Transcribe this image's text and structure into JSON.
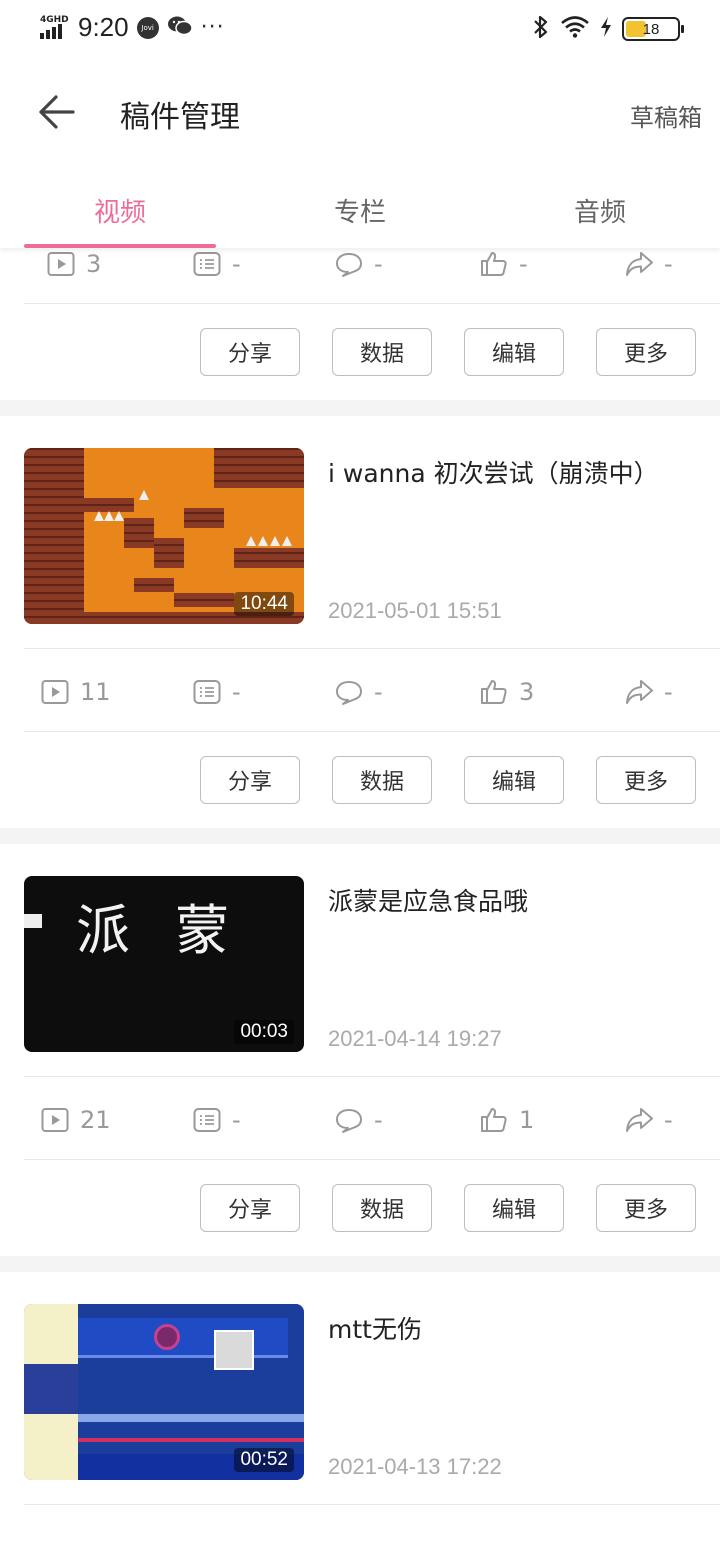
{
  "status_bar": {
    "network": "4GHD",
    "time": "9:20",
    "app_badge": "Jovi",
    "more": "···",
    "battery": "18"
  },
  "header": {
    "title": "稿件管理",
    "drafts_label": "草稿箱"
  },
  "tabs": [
    {
      "label": "视频",
      "active": true
    },
    {
      "label": "专栏",
      "active": false
    },
    {
      "label": "音频",
      "active": false
    }
  ],
  "colors": {
    "accent": "#ee6d97"
  },
  "action_labels": [
    "分享",
    "数据",
    "编辑",
    "更多"
  ],
  "partial_item": {
    "stats": {
      "plays": "3",
      "danmaku": "-",
      "comments": "-",
      "likes": "-",
      "shares": "-"
    }
  },
  "videos": [
    {
      "title": "i wanna 初次尝试（崩溃中）",
      "date": "2021-05-01 15:51",
      "duration": "10:44",
      "stats": {
        "plays": "11",
        "danmaku": "-",
        "comments": "-",
        "likes": "3",
        "shares": "-"
      }
    },
    {
      "title": "派蒙是应急食品哦",
      "date": "2021-04-14 19:27",
      "duration": "00:03",
      "thumb_text": "派 蒙",
      "stats": {
        "plays": "21",
        "danmaku": "-",
        "comments": "-",
        "likes": "1",
        "shares": "-"
      }
    },
    {
      "title": "mtt无伤",
      "date": "2021-04-13 17:22",
      "duration": "00:52"
    }
  ]
}
